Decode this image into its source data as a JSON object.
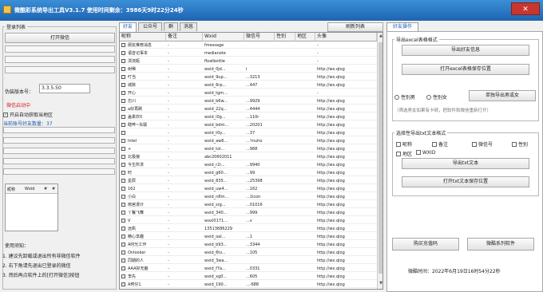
{
  "window": {
    "title": "微酷彩系统导出工具V3.1.7  使用时间剩余：3986天9时22分24秒",
    "close_label": "✕"
  },
  "left": {
    "group_title": "登录列表",
    "open_wechat": "打开微信",
    "version_label": "伪装版本号：",
    "version_value": "3.3.5.50",
    "status_text": "微信启动中",
    "auto_read_label": "开启自动获取当地区",
    "friend_count_label": "当前账号好友数量：37",
    "mini_grid_headers": [
      "昵称",
      "Wxid",
      "#",
      "#"
    ],
    "usage_title": "使用须知：",
    "usage_lines": [
      "1. 建议先卸载或退出所有非微信软件",
      "2. 右下角请先退出已登录的微信",
      "3. 然后再点软件上的[打开微信]按钮"
    ]
  },
  "center": {
    "tabs": [
      "好友",
      "公众号",
      "群",
      "消息"
    ],
    "refresh_label": "刷新列表",
    "columns": [
      "昵称",
      "备注",
      "Wxid",
      "微信号",
      "性别",
      "地区",
      "头像"
    ],
    "rows": [
      [
        "朋友推荐消息",
        "-",
        "fmessage",
        "",
        "",
        "",
        "-"
      ],
      [
        "语音记事本",
        "-",
        "medianote",
        "",
        "",
        "",
        "-"
      ],
      [
        "漂流瓶",
        "-",
        "floatbottle",
        "",
        "",
        "",
        "-"
      ],
      [
        "树稀",
        "-",
        "wxid_0jd...",
        "i",
        "",
        "",
        "http://wx.qlog"
      ],
      [
        "叮当",
        "-",
        "wxid_9up...",
        "...3213",
        "",
        "",
        "http://wx.qlog"
      ],
      [
        "城默",
        "-",
        "wxid_6rp...",
        "...447",
        "",
        "",
        "http://wx.qlog"
      ],
      [
        "开心",
        "-",
        "wxid_tgm...",
        "",
        "",
        "",
        "-"
      ],
      [
        "忘川",
        "-",
        "wxid_b6w...",
        "...9929",
        "",
        "",
        "http://wx.qlog"
      ],
      [
        "a好再刷",
        "-",
        "wxid_22q...",
        "...4444",
        "",
        "",
        "http://wx.qlog"
      ],
      [
        "盖柔炊0",
        "-",
        "wxid_i0g...",
        "...110r",
        "",
        "",
        "http://wx.qlog"
      ],
      [
        "瞎哔~失联",
        "-",
        "wxid_bdm...",
        "...20201",
        "",
        "",
        "http://wx.qlog"
      ],
      [
        "",
        "-",
        "wxid_t0y...",
        "...37",
        "",
        "",
        "http://wx.qlog"
      ],
      [
        "Intel",
        "-",
        "wxid_aw6...",
        "...'muho",
        "",
        "",
        "http://wx.qlog"
      ],
      [
        "+",
        "-",
        "wxid_tol...",
        "...968",
        "",
        "",
        "http://wx.qlog"
      ],
      [
        "北极狼",
        "-",
        "abc20602011",
        "",
        "",
        "",
        "http://wx.qlog"
      ],
      [
        "今生所求",
        "-",
        "wxid_r2i...",
        "...9940",
        "",
        "",
        "http://wx.qlog"
      ],
      [
        "时",
        "-",
        "wxid_g60...",
        "...99",
        "",
        "",
        "http://wx.qlog"
      ],
      [
        "星辰",
        "-",
        "wxid_835...",
        "...25398",
        "",
        "",
        "http://wx.qlog"
      ],
      [
        "162",
        "-",
        "wxid_uw4...",
        "...162",
        "",
        "",
        "http://wx.qlog"
      ],
      [
        "小白",
        "-",
        "wxid_n8m...",
        "...1lcon",
        "",
        "",
        "http://wx.qlog"
      ],
      [
        "南宫漫计",
        "-",
        "wxid_srg...",
        "...01016",
        "",
        "",
        "http://wx.qlog"
      ],
      [
        "丫鬟飞舞",
        "-",
        "wxid_340...",
        "...999",
        "",
        "",
        "http://wx.qlog"
      ],
      [
        "V",
        "-",
        "wxxl0171...",
        "...v",
        "",
        "",
        "http://wx.qlog"
      ],
      [
        "远帆",
        "-",
        "13513686229",
        "",
        "",
        "",
        "http://wx.qlog"
      ],
      [
        "精心享趣",
        "-",
        "wxid_oal...",
        "...1",
        "",
        "",
        "http://wx.qlog"
      ],
      [
        "A时光工作",
        "-",
        "wxid_b93...",
        "...3344",
        "",
        "",
        "http://wx.qlog"
      ],
      [
        "Onlooker",
        "-",
        "wxid_6tv...",
        "...105",
        "",
        "",
        "http://wx.qlog"
      ],
      [
        "同期的人",
        "-",
        "wxid_3wa...",
        "",
        "",
        "",
        "http://wx.qlog"
      ],
      [
        "AAA好无脑",
        "-",
        "wxid_f7a...",
        "...0331",
        "",
        "",
        "http://wx.qlog"
      ],
      [
        "李先",
        "-",
        "wxid_xg0...",
        "...605",
        "",
        "",
        "http://wx.qlog"
      ],
      [
        "A珂仔1",
        "-",
        "wxid_190...",
        "...-688",
        "",
        "",
        "http://wx.qlog"
      ]
    ]
  },
  "right": {
    "tab_label": "好友操作",
    "excel_group_title": "导出excel表格格式",
    "export_friends": "导出好友信息",
    "open_excel_location": "打开excel表格保存位置",
    "radio_male": "性别男",
    "radio_female": "性别女",
    "export_single": "单独导出男或女",
    "hint_text": "（筛选男女如果有卡顿，把软件和微信重新打开）",
    "txt_group_title": "选择性导出txt文本格式",
    "txt_options": [
      "昵称",
      "备注",
      "微信号",
      "性别",
      "地区",
      "WXID"
    ],
    "export_txt": "导出txt文本",
    "open_txt_location": "打开txt文本保存位置",
    "buy_code": "购买充值码",
    "wechat_series": "微酷系列软件",
    "expire_text": "微酷时间：2022年6月19日16时54分22秒"
  }
}
